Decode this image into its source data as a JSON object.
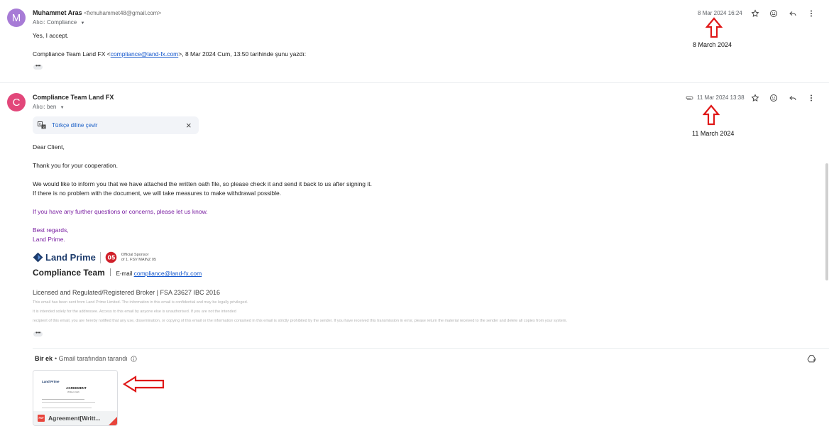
{
  "email1": {
    "avatar_letter": "M",
    "avatar_color": "#a77bd6",
    "sender_name": "Muhammet Aras",
    "sender_email": "<fxmuhammet48@gmail.com>",
    "to_line": "Alıcı: Compliance",
    "date": "8 Mar 2024 16:24",
    "body_line1": "Yes, I accept.",
    "quote_prefix": "Compliance Team Land FX <",
    "quote_link": "compliance@land-fx.com",
    "quote_suffix": ">, 8 Mar 2024 Cum, 13:50 tarihinde şunu yazdı:",
    "dots": "•••"
  },
  "email2": {
    "avatar_letter": "C",
    "avatar_color": "#e2477a",
    "sender_name": "Compliance Team Land FX",
    "to_line": "Alıcı: ben",
    "date": "11 Mar 2024 13:38",
    "translate_label": "Türkçe diline çevir",
    "greeting": "Dear Client,",
    "p1": "Thank you for your cooperation.",
    "p2a": "We would like to inform you that we have attached the written oath file, so please check it and send it back to us after signing it.",
    "p2b": "If there is no problem with the document, we will take measures to make withdrawal possible.",
    "p3": "If you have any further questions or concerns, please let us know.",
    "regards1": "Best regards,",
    "regards2": "Land Prime.",
    "logo_text": "Land Prime",
    "sponsor1": "Official Sponsor",
    "sponsor2": "of 1. FSV MAINZ 05",
    "team_title": "Compliance Team",
    "email_label": "E-mail",
    "email_link": "compliance@land-fx.com",
    "licensed": "Licensed and Regulated/Registered Broker | FSA 23627 IBC 2016",
    "disc1": "This email has been sent from Land Prime Limited. The information in this email is confidential and may be legally privileged.",
    "disc2": "It is intended solely for the addressee. Access to this email by anyone else is unauthorised. If you are not the intended",
    "disc3": "recipient of this email, you are hereby notified that any use, dissemination, or copying of this email or the information contained in this email is strictly prohibited by the sender. If you have received this transmission in error, please return the material received to the sender and delete all copies from your system.",
    "dots": "•••"
  },
  "attachments": {
    "title": "Bir ek",
    "scanned": " • Gmail tarafından tarandı",
    "file_name": "Agreement[Writt...",
    "file_type": "PDF",
    "thumb_logo": "Land Prime",
    "thumb_title": "AGREEMENT",
    "thumb_subtitle": "Written Oath"
  },
  "annotations": {
    "label1": "8 March 2024",
    "label2": "11 March 2024",
    "arrow_color": "#e01818"
  }
}
